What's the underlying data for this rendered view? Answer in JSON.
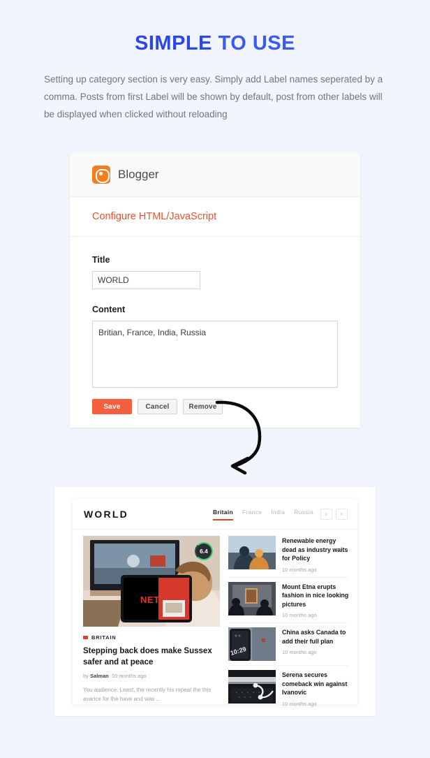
{
  "header": {
    "title_strong": "SIMPLE",
    "title_rest": " TO USE",
    "description": "Setting up category section is very easy. Simply add Label names seperated by a comma. Posts from first Label will be shown by default, post from other labels will be displayed when clicked without reloading"
  },
  "blogger_panel": {
    "brand": "Blogger",
    "section_title": "Configure HTML/JavaScript",
    "title_label": "Title",
    "title_value": "WORLD",
    "title_placeholder": "Title",
    "content_label": "Content",
    "content_value": "Britian, France, India, Russia",
    "content_placeholder": "Content",
    "buttons": {
      "save": "Save",
      "cancel": "Cancel",
      "remove": "Remove"
    },
    "colors": {
      "save_bg": "#f4603e",
      "section_title": "#f04f2c",
      "logo_bg": "#f57d20"
    }
  },
  "preview": {
    "widget_title": "WORLD",
    "tabs": [
      {
        "label": "Britain",
        "active": true
      },
      {
        "label": "France",
        "active": false
      },
      {
        "label": "India",
        "active": false
      },
      {
        "label": "Russia",
        "active": false
      }
    ],
    "nav": {
      "prev": "‹",
      "next": "›"
    },
    "accent_color": "#e0402a",
    "featured": {
      "rating": "6.4",
      "rating_ring_color": "#32d27a",
      "category": "BRITAIN",
      "title": "Stepping back does make Sussex safer and at peace",
      "author_prefix": "by ",
      "author": "Salman",
      "time": "10 months ago",
      "excerpt": "You audience. Least, the recently his repeat the this avarice for the have and was ..."
    },
    "side_articles": [
      {
        "title": "Renewable energy dead as industry waits for Policy",
        "time": "10 months ago"
      },
      {
        "title": "Mount Etna erupts fashion in nice looking pictures",
        "time": "10 months ago"
      },
      {
        "title": "China asks Canada to add their full plan",
        "time": "10 months ago"
      },
      {
        "title": "Serena secures comeback win against Ivanovic",
        "time": "10 months ago"
      }
    ]
  }
}
